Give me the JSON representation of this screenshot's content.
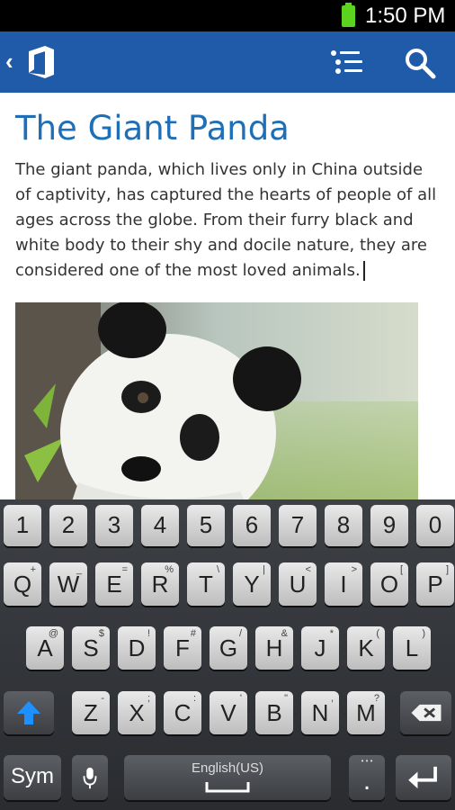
{
  "status": {
    "time": "1:50 PM"
  },
  "app": {
    "back_label": "‹"
  },
  "document": {
    "title": "The Giant Panda",
    "body": "The giant panda, which lives only in China outside of captivity, has captured the hearts of people of all ages across the globe. From their furry black and white body to their shy and docile nature, they are considered one of the most loved animals."
  },
  "keyboard": {
    "numbers": [
      "1",
      "2",
      "3",
      "4",
      "5",
      "6",
      "7",
      "8",
      "9",
      "0"
    ],
    "row1": [
      {
        "k": "Q",
        "s": "+"
      },
      {
        "k": "W",
        "s": "_"
      },
      {
        "k": "E",
        "s": "="
      },
      {
        "k": "R",
        "s": "%"
      },
      {
        "k": "T",
        "s": "\\"
      },
      {
        "k": "Y",
        "s": "|"
      },
      {
        "k": "U",
        "s": "<"
      },
      {
        "k": "I",
        "s": ">"
      },
      {
        "k": "O",
        "s": "["
      },
      {
        "k": "P",
        "s": "]"
      }
    ],
    "row2": [
      {
        "k": "A",
        "s": "@"
      },
      {
        "k": "S",
        "s": "$"
      },
      {
        "k": "D",
        "s": "!"
      },
      {
        "k": "F",
        "s": "#"
      },
      {
        "k": "G",
        "s": "/"
      },
      {
        "k": "H",
        "s": "&"
      },
      {
        "k": "J",
        "s": "*"
      },
      {
        "k": "K",
        "s": "("
      },
      {
        "k": "L",
        "s": ")"
      }
    ],
    "row3": [
      {
        "k": "Z",
        "s": "-"
      },
      {
        "k": "X",
        "s": ";"
      },
      {
        "k": "C",
        "s": ":"
      },
      {
        "k": "V",
        "s": "'"
      },
      {
        "k": "B",
        "s": "\""
      },
      {
        "k": "N",
        "s": ","
      },
      {
        "k": "M",
        "s": "?"
      }
    ],
    "sym_label": "Sym",
    "space_label": "English(US)",
    "period": ".",
    "period_sub": "• • •"
  }
}
